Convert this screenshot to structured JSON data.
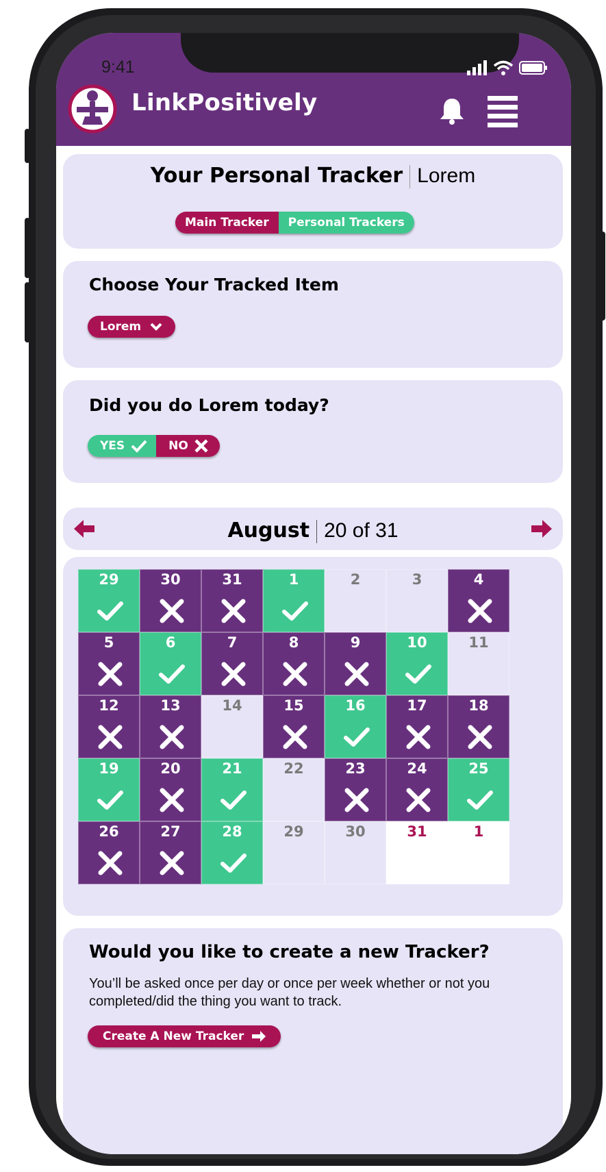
{
  "status_bar": {
    "time": "9:41"
  },
  "app": {
    "name": "LinkPositively"
  },
  "header": {
    "icons": [
      "logo-icon",
      "bell-icon",
      "hamburger-menu-icon"
    ]
  },
  "tracker_card": {
    "title": "Your Personal Tracker",
    "subtitle": "Lorem",
    "tabs": [
      {
        "label": "Main Tracker",
        "active": true
      },
      {
        "label": "Personal Trackers",
        "active": false
      }
    ]
  },
  "choose_card": {
    "heading": "Choose Your Tracked Item",
    "selected_item": "Lorem"
  },
  "question_card": {
    "heading": "Did you do Lorem today?",
    "yes_label": "YES",
    "no_label": "NO"
  },
  "calendar": {
    "month": "August",
    "progress": "20 of 31",
    "days": [
      {
        "n": "29",
        "s": "yes"
      },
      {
        "n": "30",
        "s": "no"
      },
      {
        "n": "31",
        "s": "no"
      },
      {
        "n": "1",
        "s": "yes"
      },
      {
        "n": "2",
        "s": "empty"
      },
      {
        "n": "3",
        "s": "empty"
      },
      {
        "n": "4",
        "s": "no"
      },
      {
        "n": "5",
        "s": "no"
      },
      {
        "n": "6",
        "s": "yes"
      },
      {
        "n": "7",
        "s": "no"
      },
      {
        "n": "8",
        "s": "no"
      },
      {
        "n": "9",
        "s": "no"
      },
      {
        "n": "10",
        "s": "yes"
      },
      {
        "n": "11",
        "s": "empty"
      },
      {
        "n": "12",
        "s": "no"
      },
      {
        "n": "13",
        "s": "no"
      },
      {
        "n": "14",
        "s": "empty"
      },
      {
        "n": "15",
        "s": "no"
      },
      {
        "n": "16",
        "s": "yes"
      },
      {
        "n": "17",
        "s": "no"
      },
      {
        "n": "18",
        "s": "no"
      },
      {
        "n": "19",
        "s": "yes"
      },
      {
        "n": "20",
        "s": "no"
      },
      {
        "n": "21",
        "s": "yes"
      },
      {
        "n": "22",
        "s": "empty"
      },
      {
        "n": "23",
        "s": "no"
      },
      {
        "n": "24",
        "s": "no"
      },
      {
        "n": "25",
        "s": "yes"
      },
      {
        "n": "26",
        "s": "no"
      },
      {
        "n": "27",
        "s": "no"
      },
      {
        "n": "28",
        "s": "yes"
      },
      {
        "n": "29",
        "s": "empty"
      },
      {
        "n": "30",
        "s": "empty"
      },
      {
        "n": "31",
        "s": "blank"
      },
      {
        "n": "1",
        "s": "blank"
      }
    ]
  },
  "new_tracker_card": {
    "heading": "Would you like to create a new Tracker?",
    "description": "You’ll be asked once per day or once per week whether or not you completed/did the thing you want to track.",
    "button_label": "Create A New Tracker"
  },
  "colors": {
    "purple": "#67307d",
    "pink": "#a91354",
    "green": "#3ec78f",
    "card_bg": "#e7e4f7"
  }
}
